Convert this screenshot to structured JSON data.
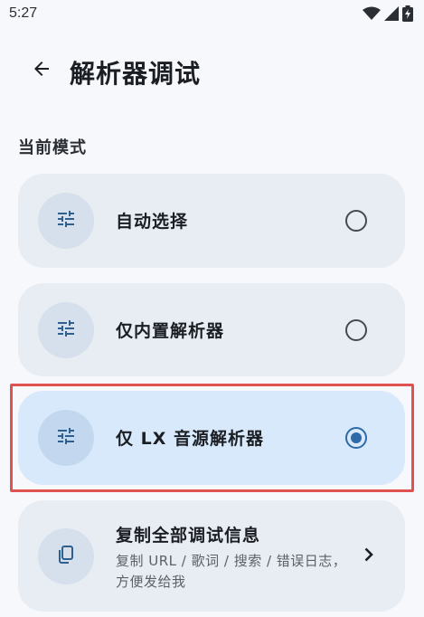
{
  "status_bar": {
    "time": "5:27",
    "icons": [
      "wifi-icon",
      "signal-icon",
      "battery-charging-icon"
    ]
  },
  "header": {
    "back_icon": "arrow-left-icon",
    "title": "解析器调试"
  },
  "section": {
    "label": "当前模式"
  },
  "modes": [
    {
      "label": "自动选择",
      "icon": "tune-icon",
      "selected": false
    },
    {
      "label": "仅内置解析器",
      "icon": "tune-icon",
      "selected": false
    },
    {
      "label": "仅 LX 音源解析器",
      "icon": "tune-icon",
      "selected": true
    }
  ],
  "copy_action": {
    "title": "复制全部调试信息",
    "subtitle": "复制 URL / 歌词 / 搜索 / 错误日志，方便发给我",
    "icon": "copy-icon",
    "trailing_icon": "chevron-right-icon"
  },
  "colors": {
    "background": "#f6f8fc",
    "card": "#e8edf3",
    "card_selected": "#d8e9fb",
    "accent": "#2e6aa8",
    "highlight": "#e05252"
  }
}
